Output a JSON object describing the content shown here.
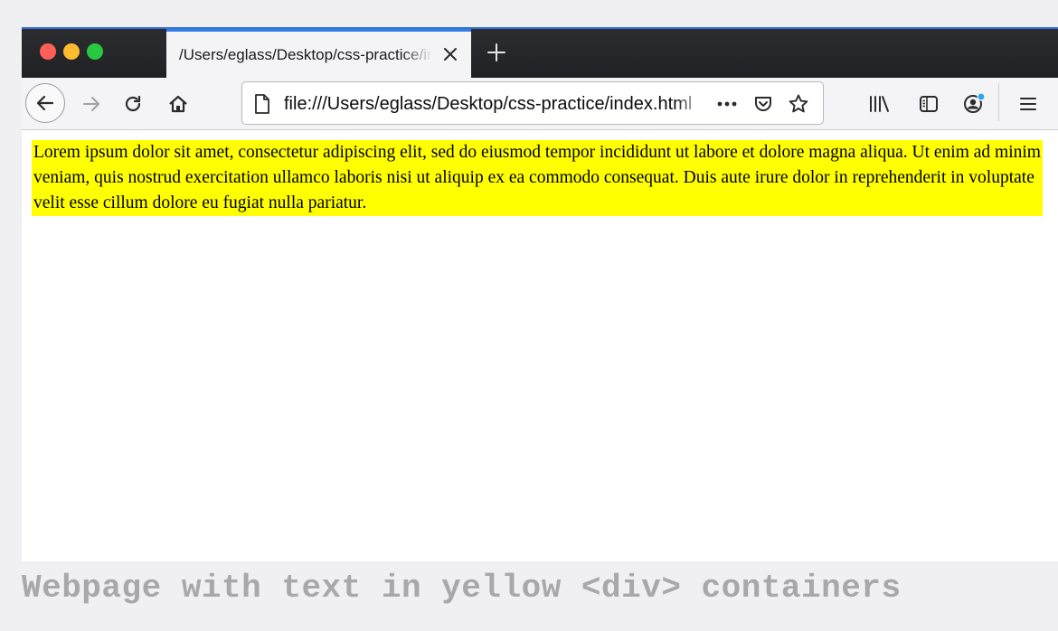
{
  "browser": {
    "tab": {
      "title": "/Users/eglass/Desktop/css-practice/index.html"
    },
    "address_bar": {
      "url": "file:///Users/eglass/Desktop/css-practice/index.html"
    },
    "icons": {
      "back": "back-arrow-icon",
      "forward": "forward-arrow-icon",
      "reload": "reload-icon",
      "home": "home-icon",
      "page": "page-icon",
      "more": "more-actions-icon",
      "pocket": "pocket-icon",
      "bookmark": "star-bookmark-icon",
      "library": "library-icon",
      "sidebar": "sidebar-icon",
      "account": "account-icon",
      "menu": "hamburger-menu-icon"
    },
    "colors": {
      "close_red": "#fe5f57",
      "minimize_yellow": "#febc2e",
      "zoom_green": "#28c840",
      "tab_accent": "#2e7fe8",
      "notification_dot": "#2aa7f0"
    }
  },
  "page": {
    "paragraph": "Lorem ipsum dolor sit amet, consectetur adipiscing elit, sed do eiusmod tempor incididunt ut labore et dolore magna aliqua. Ut enim ad minim veniam, quis nostrud exercitation ullamco laboris nisi ut aliquip ex ea commodo consequat. Duis aute irure dolor in reprehenderit in voluptate velit esse cillum dolore eu fugiat nulla pariatur.",
    "highlight_color": "#ffff00"
  },
  "caption": "Webpage with text in yellow <div> containers"
}
